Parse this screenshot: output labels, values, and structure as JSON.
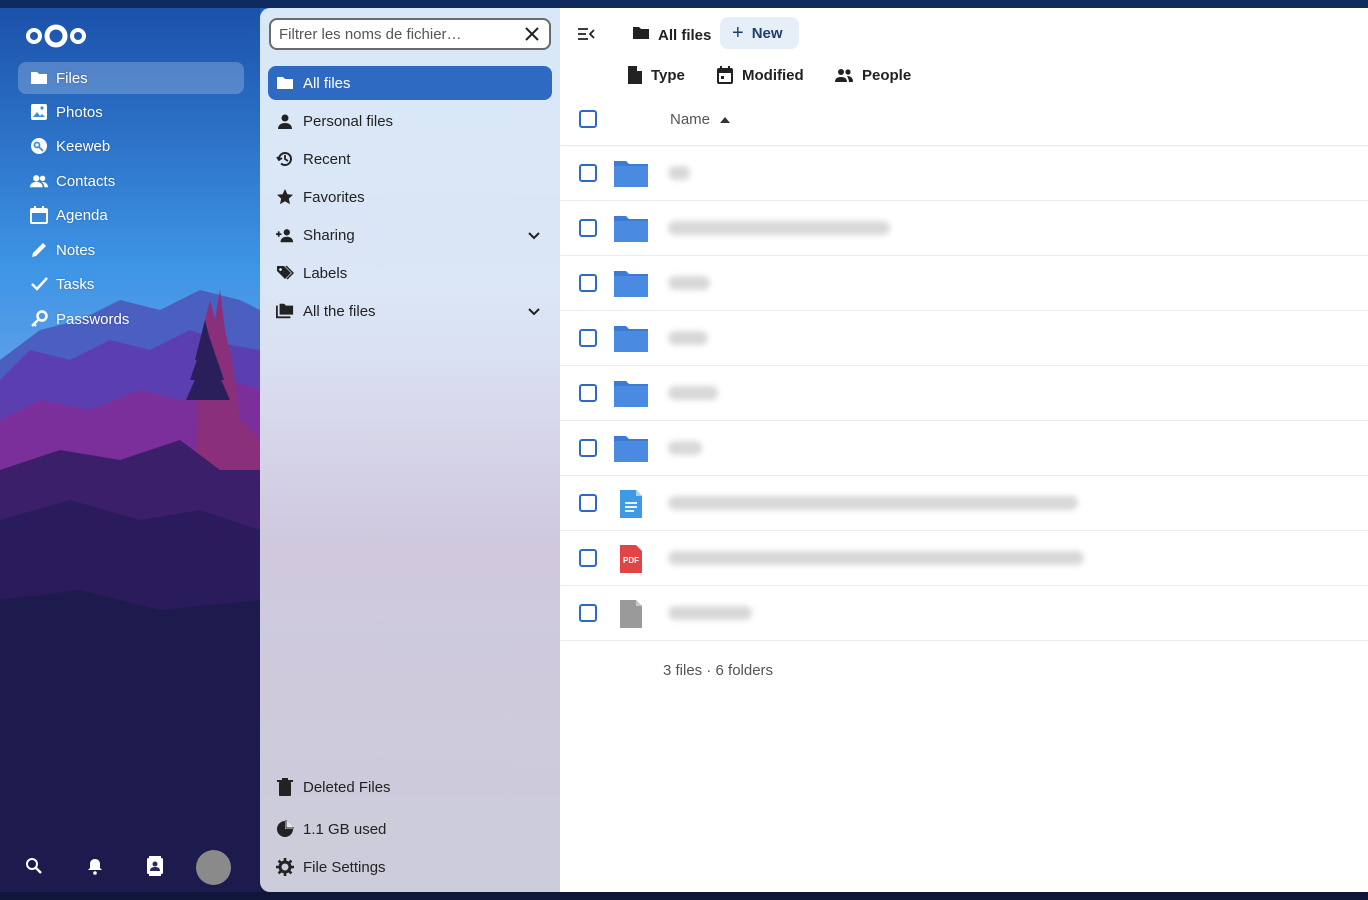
{
  "app_nav": {
    "items": [
      {
        "label": "Files",
        "icon": "folder-icon",
        "active": true
      },
      {
        "label": "Photos",
        "icon": "image-icon",
        "active": false
      },
      {
        "label": "Keeweb",
        "icon": "key-icon",
        "active": false
      },
      {
        "label": "Contacts",
        "icon": "contacts-icon",
        "active": false
      },
      {
        "label": "Agenda",
        "icon": "calendar-icon",
        "active": false
      },
      {
        "label": "Notes",
        "icon": "pencil-icon",
        "active": false
      },
      {
        "label": "Tasks",
        "icon": "check-icon",
        "active": false
      },
      {
        "label": "Passwords",
        "icon": "key-icon",
        "active": false
      }
    ],
    "bottom_icons": [
      "search-icon",
      "bell-icon",
      "contacts-book-icon",
      "avatar"
    ]
  },
  "files_nav": {
    "search_placeholder": "Filtrer les noms de fichier…",
    "items": [
      {
        "label": "All files",
        "icon": "folder-icon",
        "active": true
      },
      {
        "label": "Personal files",
        "icon": "person-icon",
        "active": false
      },
      {
        "label": "Recent",
        "icon": "history-icon",
        "active": false
      },
      {
        "label": "Favorites",
        "icon": "star-icon",
        "active": false
      },
      {
        "label": "Sharing",
        "icon": "share-icon",
        "active": false,
        "expandable": true
      },
      {
        "label": "Labels",
        "icon": "tag-icon",
        "active": false
      },
      {
        "label": "All the files",
        "icon": "folders-icon",
        "active": false,
        "expandable": true
      }
    ],
    "footer": {
      "deleted": "Deleted Files",
      "quota": "1.1 GB used",
      "settings": "File Settings"
    }
  },
  "main": {
    "breadcrumb": "All files",
    "new_button": "New",
    "filters": [
      "Type",
      "Modified",
      "People"
    ],
    "column_name": "Name",
    "rows": [
      {
        "type": "folder"
      },
      {
        "type": "folder"
      },
      {
        "type": "folder"
      },
      {
        "type": "folder"
      },
      {
        "type": "folder"
      },
      {
        "type": "folder"
      },
      {
        "type": "document"
      },
      {
        "type": "pdf"
      },
      {
        "type": "file"
      }
    ],
    "summary": "3 files · 6 folders"
  },
  "colors": {
    "accent": "#2e6ac2",
    "folder": "#3a7bd5",
    "pdf": "#e04444"
  }
}
